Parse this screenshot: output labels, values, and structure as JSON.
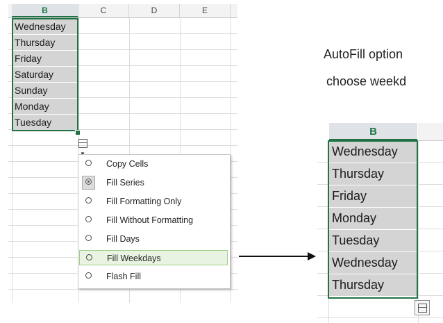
{
  "left_sheet": {
    "columns": [
      "B",
      "C",
      "D",
      "E"
    ],
    "cells_b": [
      "Wednesday",
      "Thursday",
      "Friday",
      "Saturday",
      "Sunday",
      "Monday",
      "Tuesday"
    ]
  },
  "autofill_menu": {
    "items": [
      {
        "label": "Copy Cells"
      },
      {
        "label": "Fill Series"
      },
      {
        "label": "Fill Formatting Only"
      },
      {
        "label": "Fill Without Formatting"
      },
      {
        "label": "Fill Days"
      },
      {
        "label": "Fill Weekdays"
      },
      {
        "label": "Flash Fill"
      }
    ],
    "selected": "Fill Series",
    "highlighted": "Fill Weekdays"
  },
  "caption": {
    "line1": "AutoFill option",
    "line2": "choose weekd"
  },
  "right_sheet": {
    "column": "B",
    "cells_b": [
      "Wednesday",
      "Thursday",
      "Friday",
      "Monday",
      "Tuesday",
      "Wednesday",
      "Thursday"
    ]
  },
  "colors": {
    "accent": "#217346",
    "selection_fill": "#d4d4d4",
    "hover_fill": "#e9f3e2"
  },
  "icons": {
    "autofill_options": "autofill-options-icon",
    "dropdown": "chevron-down-icon",
    "radio": "radio-icon",
    "arrow": "arrow-right-icon"
  }
}
